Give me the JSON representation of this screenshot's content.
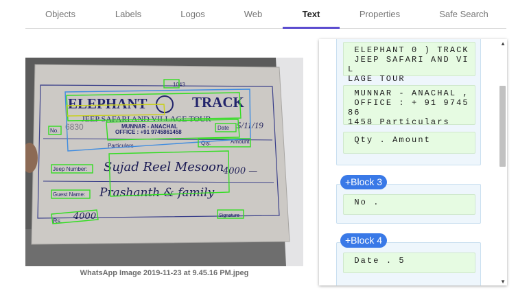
{
  "tabs": [
    {
      "label": "Objects"
    },
    {
      "label": "Labels"
    },
    {
      "label": "Logos"
    },
    {
      "label": "Web"
    },
    {
      "label": "Text"
    },
    {
      "label": "Properties"
    },
    {
      "label": "Safe Search"
    }
  ],
  "active_tab": "Text",
  "accent_color": "#5b4ccf",
  "image": {
    "caption": "WhatsApp Image 2019-11-23 at 9.45.16 PM.jpeg",
    "receipt_text": {
      "serial": "1043",
      "title_left": "ELEPHANT",
      "title_right": "TRACK",
      "subtitle": "JEEP SAFARI AND VILLAGE TOUR",
      "address_line1": "MUNNAR - ANACHAL",
      "address_line2": "OFFICE : +91 9745861458",
      "no_label": "No.",
      "number": "6830",
      "date_label": "Date",
      "date_value": "5/11/19",
      "particulars": "Particulars",
      "qty": "Qty.",
      "amount": "Amount",
      "jeep_label": "Jeep Number:",
      "jeep_value": "Sujad Reel Mesoon",
      "amount_value": "4000 —",
      "guest_label": "Guest Name:",
      "guest_value": "Prashanth & family",
      "rs_label": "Rs.",
      "rs_value": "4000",
      "signature": "Signature"
    }
  },
  "results": {
    "paragraphs": [
      {
        "text": " ELEPHANT 0 ) TRACK\n JEEP SAFARI AND VIL\nLAGE TOUR"
      },
      {
        "text": " MUNNAR - ANACHAL ,\n OFFICE : + 91 974586\n1458 Particulars"
      },
      {
        "text": " Qty . Amount"
      },
      {
        "text": " No ."
      },
      {
        "text": " Date . 5"
      }
    ],
    "blocks": [
      {
        "label": "+Block 3"
      },
      {
        "label": "+Block 4"
      }
    ],
    "chip_color": "#3979e7"
  },
  "icons": {
    "scroll_up": "triangle-up-icon",
    "scroll_down": "triangle-down-icon"
  }
}
